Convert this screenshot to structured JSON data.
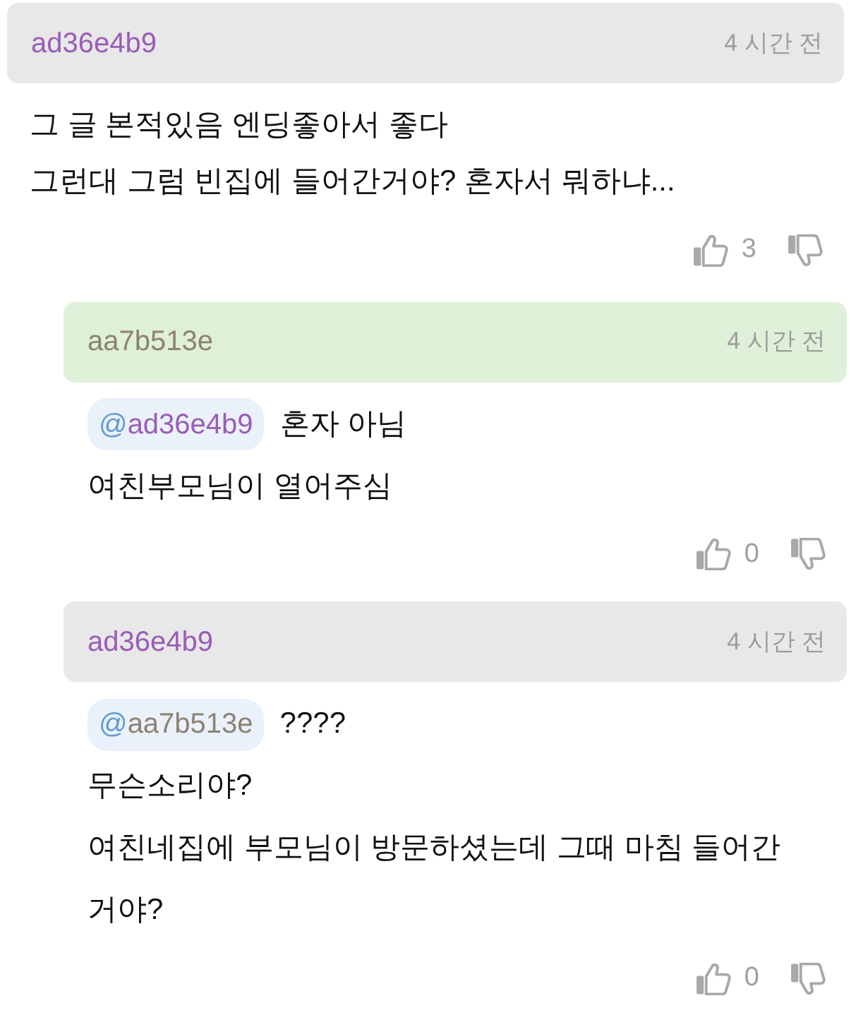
{
  "comments": [
    {
      "user": "ad36e4b9",
      "color": "#9a5cb8",
      "time": "4 시간 전",
      "highlighted": false,
      "lines": [
        "그 글 본적있음 엔딩좋아서 좋다",
        "그런대 그럼 빈집에 들어간거야? 혼자서 뭐하냐..."
      ],
      "likes": "3",
      "replies": [
        {
          "user": "aa7b513e",
          "color": "#8c8272",
          "time": "4 시간 전",
          "highlighted": true,
          "mention": {
            "prefix": "@",
            "user": "ad36e4b9",
            "color": "#9a5cb8"
          },
          "lines": [
            "혼자 아님",
            "여친부모님이 열어주심"
          ],
          "likes": "0"
        },
        {
          "user": "ad36e4b9",
          "color": "#9a5cb8",
          "time": "4 시간 전",
          "highlighted": false,
          "mention": {
            "prefix": "@",
            "user": "aa7b513e",
            "color": "#8c8272"
          },
          "lines": [
            "????",
            "무슨소리야?",
            "여친네집에 부모님이 방문하셨는데 그때 마침 들어간 거야?"
          ],
          "likes": "0"
        }
      ]
    }
  ]
}
